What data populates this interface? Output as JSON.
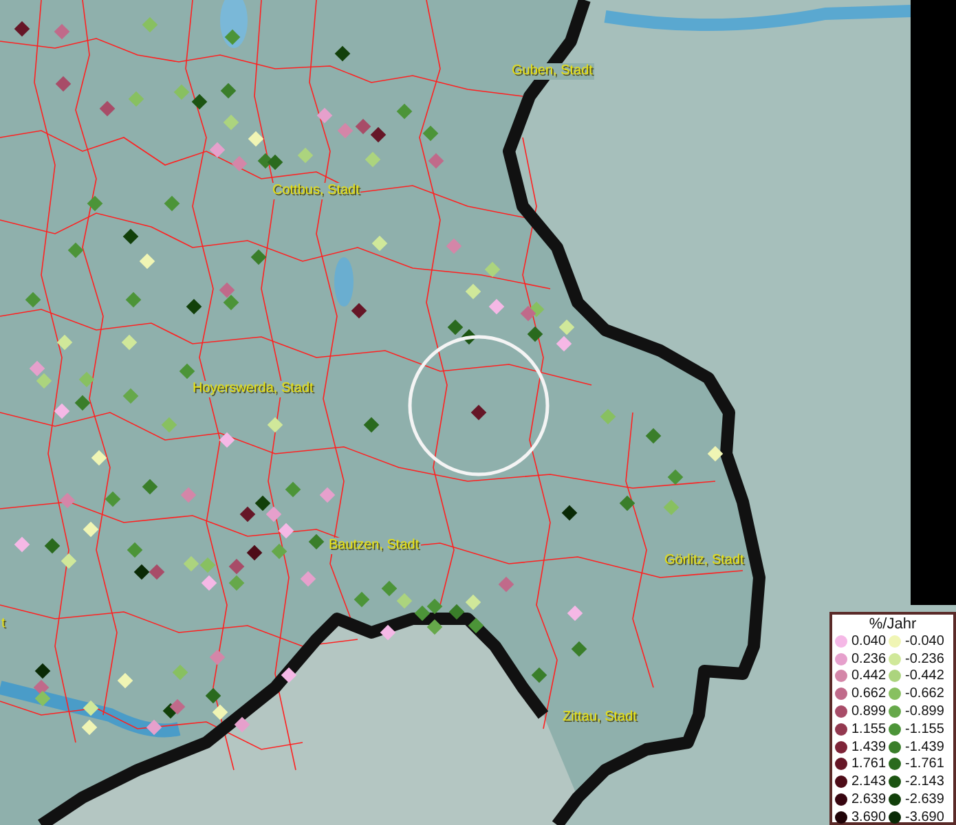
{
  "map": {
    "place_labels": [
      {
        "text": "Guben, Stadt"
      },
      {
        "text": "Cottbus, Stadt"
      },
      {
        "text": "Hoyerswerda, Stadt"
      },
      {
        "text": "Bautzen, Stadt"
      },
      {
        "text": "Görlitz, Stadt"
      },
      {
        "text": "Zittau, Stadt"
      },
      {
        "text": "t"
      }
    ]
  },
  "legend": {
    "title": "%/Jahr",
    "positive": [
      {
        "label": "0.040",
        "color": "#f5b8e6"
      },
      {
        "label": "0.236",
        "color": "#e6a0cc"
      },
      {
        "label": "0.442",
        "color": "#d486a8"
      },
      {
        "label": "0.662",
        "color": "#c06a8a"
      },
      {
        "label": "0.899",
        "color": "#a84c68"
      },
      {
        "label": "1.155",
        "color": "#93384f"
      },
      {
        "label": "1.439",
        "color": "#7e2438"
      },
      {
        "label": "1.761",
        "color": "#661627"
      },
      {
        "label": "2.143",
        "color": "#4e0c18"
      },
      {
        "label": "2.639",
        "color": "#380610"
      },
      {
        "label": "3.690",
        "color": "#200308"
      }
    ],
    "negative": [
      {
        "label": "-0.040",
        "color": "#f0f5b4"
      },
      {
        "label": "-0.236",
        "color": "#d0e89a"
      },
      {
        "label": "-0.442",
        "color": "#acd47e"
      },
      {
        "label": "-0.662",
        "color": "#88c060"
      },
      {
        "label": "-0.899",
        "color": "#66a84a"
      },
      {
        "label": "-1.155",
        "color": "#4c9438"
      },
      {
        "label": "-1.439",
        "color": "#3a7e2a"
      },
      {
        "label": "-1.761",
        "color": "#2a6a1e"
      },
      {
        "label": "-2.143",
        "color": "#1c5412"
      },
      {
        "label": "-2.639",
        "color": "#12400a"
      },
      {
        "label": "-3.690",
        "color": "#0a2a06"
      }
    ]
  }
}
